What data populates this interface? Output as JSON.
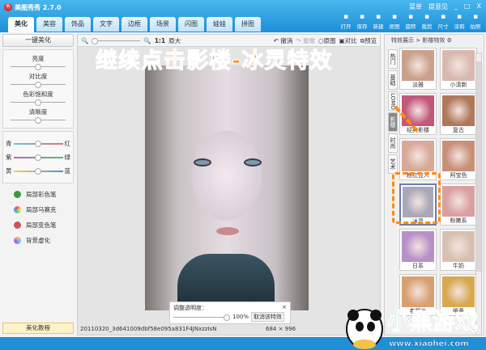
{
  "app": {
    "title": "美图秀秀 2.7.0",
    "logo": "秀",
    "menu": "菜单",
    "feedback": "提意见",
    "controls": [
      "_",
      "□",
      "X"
    ]
  },
  "tabs": [
    "美化",
    "美容",
    "饰品",
    "文字",
    "边框",
    "场景",
    "闪图",
    "娃娃",
    "拼图"
  ],
  "tools": [
    {
      "icon": "open-icon",
      "label": "打开"
    },
    {
      "icon": "save-icon",
      "label": "保存"
    },
    {
      "icon": "new-icon",
      "label": "新建"
    },
    {
      "icon": "cutout-icon",
      "label": "抠图"
    },
    {
      "icon": "rotate-icon",
      "label": "旋转"
    },
    {
      "icon": "crop-icon",
      "label": "裁剪"
    },
    {
      "icon": "size-icon",
      "label": "尺寸"
    },
    {
      "icon": "eraser-icon",
      "label": "涂鸦"
    },
    {
      "icon": "camera-icon",
      "label": "拍照"
    }
  ],
  "left": {
    "one_click": "一键美化",
    "sliders": [
      "亮度",
      "对比度",
      "色彩饱和度",
      "清晰度"
    ],
    "color_rows": [
      {
        "l": "青",
        "r": "红",
        "c": "linear-gradient(90deg,#6cc6d8,#e06f7a)"
      },
      {
        "l": "紫",
        "r": "绿",
        "c": "linear-gradient(90deg,#b06ad0,#62b86a)"
      },
      {
        "l": "黄",
        "r": "蓝",
        "c": "linear-gradient(90deg,#f0d84a,#4a90d8)"
      }
    ],
    "tools": [
      "局部彩色笔",
      "局部马赛克",
      "局部变色笔",
      "背景虚化"
    ],
    "tutorial": "美化教程"
  },
  "canvas": {
    "zoom_label": "1:1",
    "original_size": "原大",
    "undo": "撤消",
    "redo": "重做",
    "original": "原图",
    "compare": "对比",
    "preview": "预览",
    "headline": "继续点击影楼-冰灵特效",
    "opacity_label": "调整透明度：",
    "opacity_value": "100%",
    "opacity_fraction": 1.0,
    "cancel_effect": "取消该特效",
    "filename": "20110320_3d641009dbf58e095a831F4JNxzzIsN",
    "dimensions": "684 × 996"
  },
  "right": {
    "breadcrumb": "特效展示 > 影楼特效",
    "vtabs": [
      "热门",
      "基础",
      "LOMO",
      "影楼",
      "时尚",
      "艺术"
    ],
    "thumbs": [
      {
        "label": "淡雅",
        "c": "#c8a08c"
      },
      {
        "label": "小清新",
        "c": "#d8b8b0"
      },
      {
        "label": "经典影楼",
        "c": "#c0587a"
      },
      {
        "label": "复古",
        "c": "#b0785a"
      },
      {
        "label": "粉红佳人",
        "c": "#d8a898"
      },
      {
        "label": "阿宝色",
        "c": "#c89078"
      },
      {
        "label": "冰灵",
        "c": "#a8a8b8"
      },
      {
        "label": "粉嫩系",
        "c": "#d8a0a0"
      },
      {
        "label": "日系",
        "c": "#b890c8"
      },
      {
        "label": "牛奶",
        "c": "#d8c0b0"
      },
      {
        "label": "老照片",
        "c": "#d8a070"
      },
      {
        "label": "暖黄",
        "c": "#d8a850"
      }
    ]
  },
  "brand": {
    "name": "小黑游戏",
    "url": "www.xiaohei.com"
  }
}
